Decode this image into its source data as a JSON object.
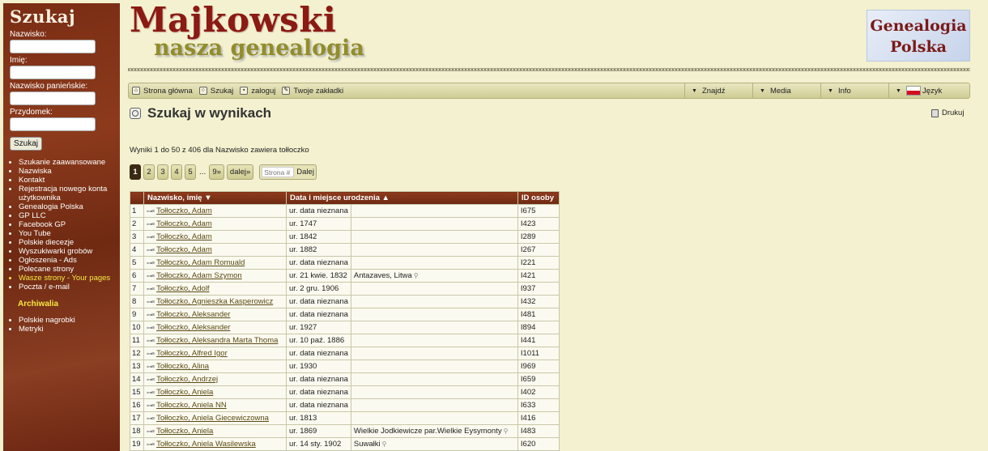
{
  "sidebar": {
    "title": "Szukaj",
    "labels": {
      "surname": "Nazwisko:",
      "firstname": "Imię:",
      "maiden": "Nazwisko panieńskie:",
      "nickname": "Przydomek:"
    },
    "search_button": "Szukaj",
    "links": [
      "Szukanie zaawansowane",
      "Nazwiska",
      "Kontakt",
      "Rejestracja nowego konta użytkownika",
      "Genealogia Polska",
      "GP LLC",
      "Facebook GP",
      "You Tube",
      "Polskie diecezje",
      "Wyszukiwarki grobów",
      "Ogłoszenia - Ads",
      "Polecane strony",
      "Wasze strony - Your pages",
      "Poczta / e-mail"
    ],
    "section_title": "Archiwalia",
    "archive_links": [
      "Polskie nagrobki",
      "Metryki"
    ]
  },
  "header": {
    "title": "Majkowski",
    "subtitle": "nasza genealogia",
    "logo_line1": "Genealogia",
    "logo_line2": "Polska"
  },
  "toolbar": {
    "home": "Strona główna",
    "search": "Szukaj",
    "login": "zaloguj",
    "bookmarks": "Twoje zakładki",
    "find": "Znajdź",
    "media": "Media",
    "info": "Info",
    "language": "Język"
  },
  "page": {
    "heading": "Szukaj w wynikach",
    "print": "Drukuj",
    "results_info": "Wyniki 1 do 50 z 406 dla Nazwisko zawiera tołłoczko"
  },
  "pagination": {
    "pages": [
      "1",
      "2",
      "3",
      "4",
      "5"
    ],
    "dots": "...",
    "last": "9»",
    "next": "dalej»",
    "page_placeholder": "Strona #",
    "go": "Dalej"
  },
  "table": {
    "headers": {
      "name": "Nazwisko, imię",
      "birth": "Data i miejsce urodzenia",
      "id": "ID osoby"
    },
    "rows": [
      {
        "n": "1",
        "name": "Tołłoczko, Adam",
        "birth": "ur. data nieznana",
        "place": "",
        "id": "I675"
      },
      {
        "n": "2",
        "name": "Tołłoczko, Adam",
        "birth": "ur. 1747",
        "place": "",
        "id": "I423"
      },
      {
        "n": "3",
        "name": "Tołłoczko, Adam",
        "birth": "ur. 1842",
        "place": "",
        "id": "I289"
      },
      {
        "n": "4",
        "name": "Tołłoczko, Adam",
        "birth": "ur. 1882",
        "place": "",
        "id": "I267"
      },
      {
        "n": "5",
        "name": "Tołłoczko, Adam Romuald",
        "birth": "ur. data nieznana",
        "place": "",
        "id": "I221"
      },
      {
        "n": "6",
        "name": "Tołłoczko, Adam Szymon",
        "birth": "ur. 21 kwie. 1832",
        "place": "Antazaves, Litwa",
        "id": "I421"
      },
      {
        "n": "7",
        "name": "Tołłoczko, Adolf",
        "birth": "ur. 2 gru. 1906",
        "place": "",
        "id": "I937"
      },
      {
        "n": "8",
        "name": "Tołłoczko, Agnieszka Kasperowicz",
        "birth": "ur. data nieznana",
        "place": "",
        "id": "I432"
      },
      {
        "n": "9",
        "name": "Tołłoczko, Aleksander",
        "birth": "ur. data nieznana",
        "place": "",
        "id": "I481"
      },
      {
        "n": "10",
        "name": "Tołłoczko, Aleksander",
        "birth": "ur. 1927",
        "place": "",
        "id": "I894"
      },
      {
        "n": "11",
        "name": "Tołłoczko, Aleksandra Marta Thoma",
        "birth": "ur. 10 paź. 1886",
        "place": "",
        "id": "I441"
      },
      {
        "n": "12",
        "name": "Tołłoczko, Alfred Igor",
        "birth": "ur. data nieznana",
        "place": "",
        "id": "I1011"
      },
      {
        "n": "13",
        "name": "Tołłoczko, Alina",
        "birth": "ur. 1930",
        "place": "",
        "id": "I969"
      },
      {
        "n": "14",
        "name": "Tołłoczko, Andrzej",
        "birth": "ur. data nieznana",
        "place": "",
        "id": "I659"
      },
      {
        "n": "15",
        "name": "Tołłoczko, Aniela",
        "birth": "ur. data nieznana",
        "place": "",
        "id": "I402"
      },
      {
        "n": "16",
        "name": "Tołłoczko, Aniela NN",
        "birth": "ur. data nieznana",
        "place": "",
        "id": "I633"
      },
      {
        "n": "17",
        "name": "Tołłoczko, Aniela Giecewiczowna",
        "birth": "ur. 1813",
        "place": "",
        "id": "I416"
      },
      {
        "n": "18",
        "name": "Tołłoczko, Aniela",
        "birth": "ur. 1869",
        "place": "Wielkie Jodkiewicze par.Wielkie Eysymonty",
        "id": "I483"
      },
      {
        "n": "19",
        "name": "Tołłoczko, Aniela Wasilewska",
        "birth": "ur. 14 sty. 1902",
        "place": "Suwałki",
        "id": "I620"
      }
    ]
  }
}
